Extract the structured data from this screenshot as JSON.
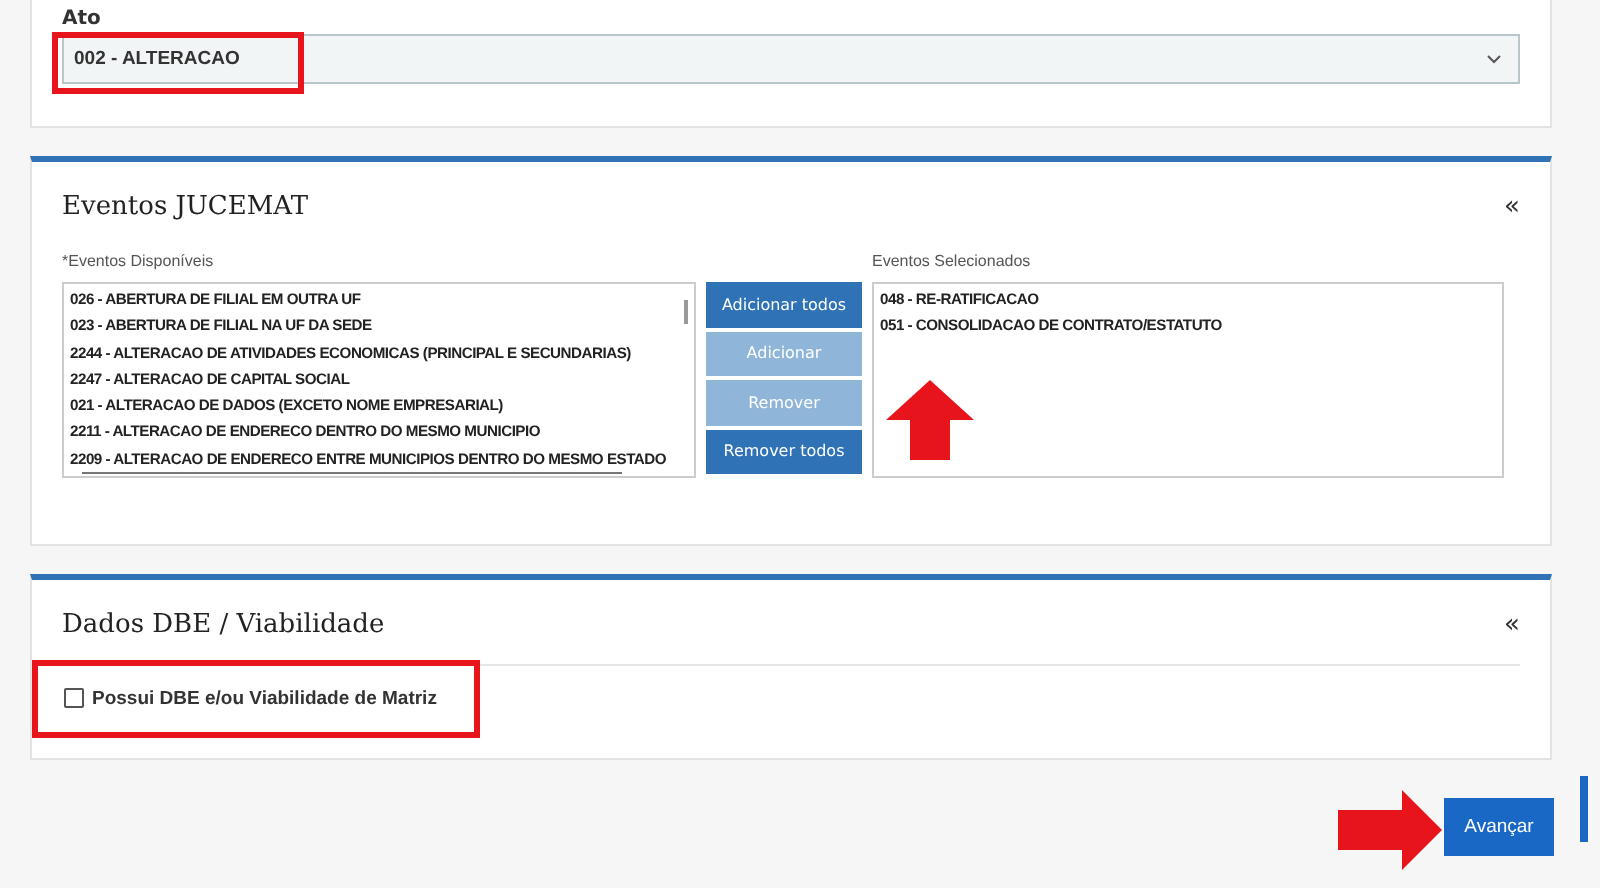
{
  "ato": {
    "label": "Ato",
    "value": "002 - ALTERACAO"
  },
  "eventos": {
    "title": "Eventos JUCEMAT",
    "collapse": "«",
    "available_label": "*Eventos Disponíveis",
    "available": [
      "026 - ABERTURA DE FILIAL EM OUTRA UF",
      "023 - ABERTURA DE FILIAL NA UF DA SEDE",
      "2244 - ALTERACAO DE ATIVIDADES ECONOMICAS (PRINCIPAL E SECUNDARIAS)",
      "2247 - ALTERACAO DE CAPITAL SOCIAL",
      "021 - ALTERACAO DE DADOS (EXCETO NOME EMPRESARIAL)",
      "2211 - ALTERACAO DE ENDERECO DENTRO DO MESMO MUNICIPIO",
      "2209 - ALTERACAO DE ENDERECO ENTRE MUNICIPIOS DENTRO DO MESMO ESTADO"
    ],
    "buttons": [
      {
        "label": "Adicionar todos",
        "disabled": false
      },
      {
        "label": "Adicionar",
        "disabled": true
      },
      {
        "label": "Remover",
        "disabled": true
      },
      {
        "label": "Remover todos",
        "disabled": false
      }
    ],
    "selected_label": "Eventos Selecionados",
    "selected_items": [
      "048 - RE-RATIFICACAO",
      "051 - CONSOLIDACAO DE CONTRATO/ESTATUTO"
    ]
  },
  "dbe": {
    "title": "Dados DBE / Viabilidade",
    "collapse": "«",
    "checkbox": {
      "label": "Possui DBE e/ou Viabilidade de Matriz",
      "checked": false
    }
  },
  "next_button": "Avançar"
}
